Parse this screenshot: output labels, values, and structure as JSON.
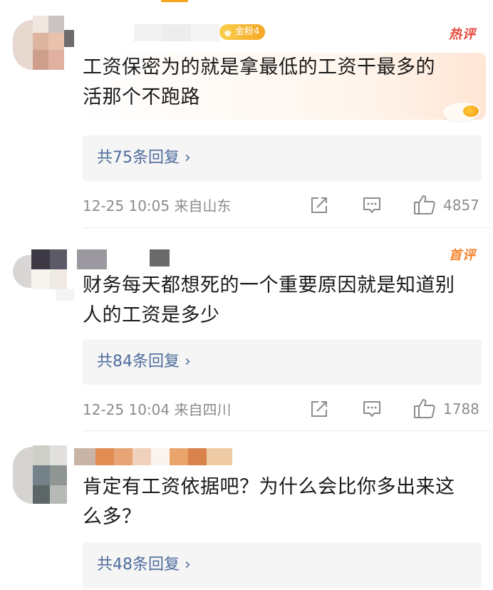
{
  "comments": [
    {
      "badge": "金粉4",
      "tag": "热评",
      "text_line1": "工资保密为的就是拿最低的工资干最多的",
      "text_line2": "活那个不跑路",
      "replies": "共75条回复 ›",
      "meta": "12-25 10:05 来自山东",
      "likes": "4857"
    },
    {
      "tag": "首评",
      "text_line1": "财务每天都想死的一个重要原因就是知道别",
      "text_line2": "人的工资是多少",
      "replies": "共84条回复 ›",
      "meta": "12-25 10:04 来自四川",
      "likes": "1788"
    },
    {
      "text_line1": "肯定有工资依据吧？为什么会比你多出来这",
      "text_line2": "么多？",
      "replies": "共48条回复 ›"
    }
  ],
  "icons": {
    "share": "share-icon",
    "comment": "comment-icon",
    "like": "thumbs-up-icon"
  },
  "colors": {
    "accent": "#f7a51c",
    "link": "#4e6c9c",
    "hot_tag": "#e8483c",
    "first_tag": "#f5822a"
  }
}
